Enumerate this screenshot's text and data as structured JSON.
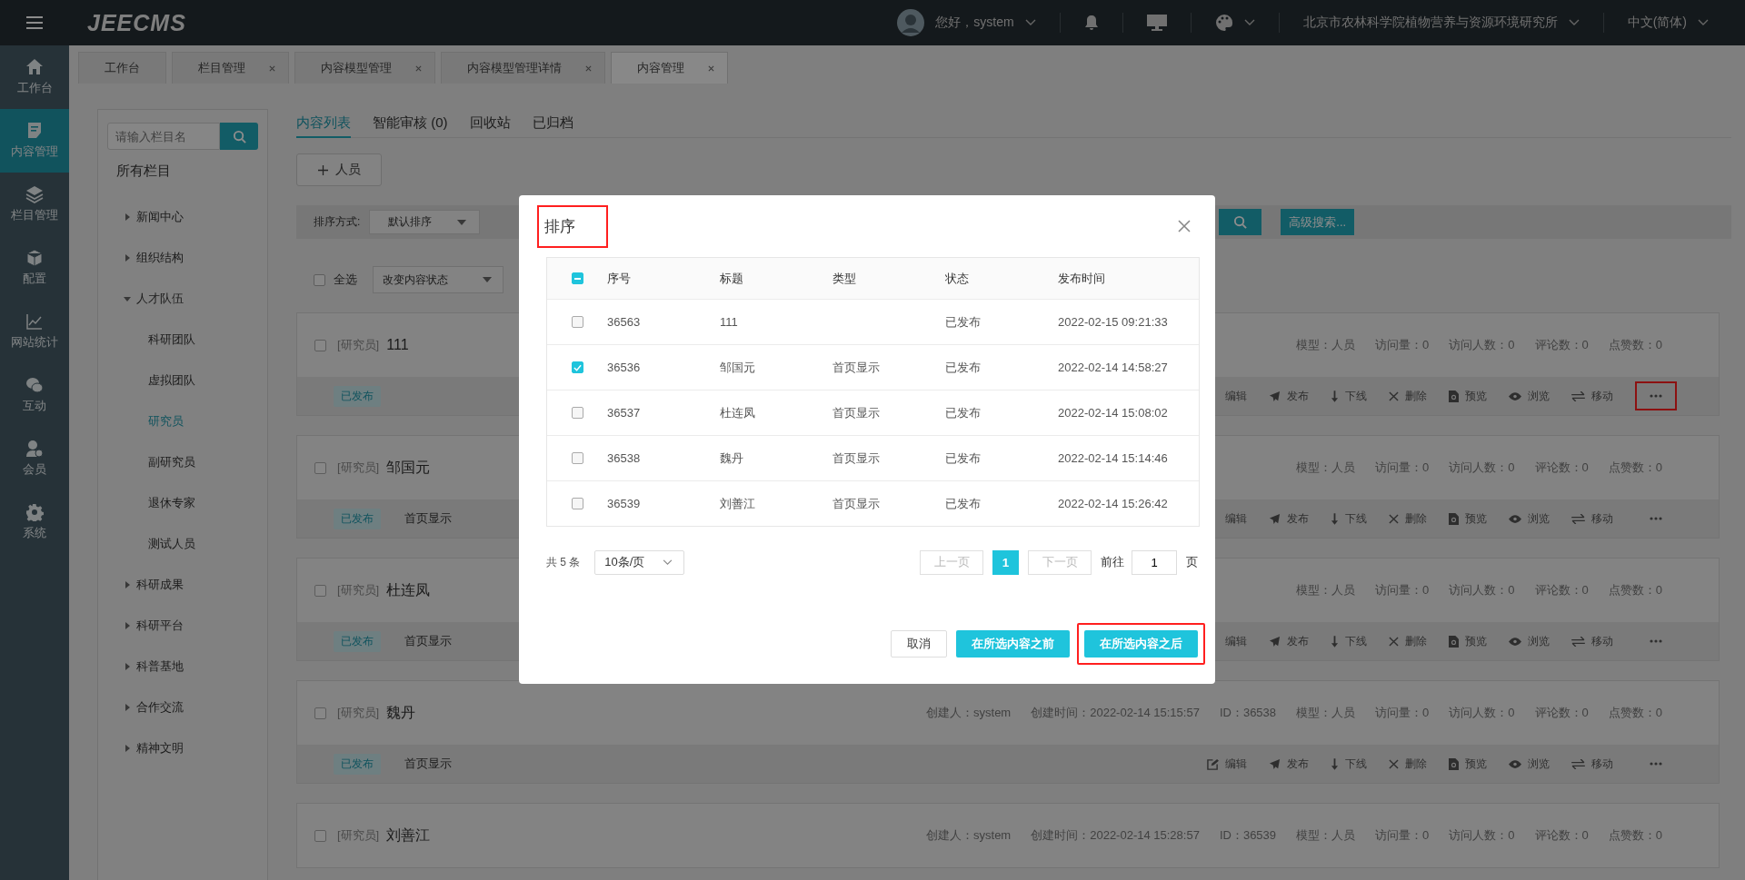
{
  "header": {
    "logo": "JEECMS",
    "greeting": "您好，system",
    "organization": "北京市农林科学院植物营养与资源环境研究所",
    "language": "中文(简体)"
  },
  "nav": [
    {
      "label": "工作台",
      "selected": false
    },
    {
      "label": "内容管理",
      "selected": true
    },
    {
      "label": "栏目管理",
      "selected": false
    },
    {
      "label": "配置",
      "selected": false
    },
    {
      "label": "网站统计",
      "selected": false
    },
    {
      "label": "互动",
      "selected": false
    },
    {
      "label": "会员",
      "selected": false
    },
    {
      "label": "系统",
      "selected": false
    }
  ],
  "tabs": [
    {
      "label": "工作台",
      "selected": false,
      "closable": false
    },
    {
      "label": "栏目管理",
      "selected": false,
      "closable": true
    },
    {
      "label": "内容模型管理",
      "selected": false,
      "closable": true
    },
    {
      "label": "内容模型管理详情",
      "selected": false,
      "closable": true
    },
    {
      "label": "内容管理",
      "selected": true,
      "closable": true
    }
  ],
  "tree": {
    "search_placeholder": "请输入栏目名",
    "root": "所有栏目",
    "items": [
      {
        "label": "新闻中心",
        "expanded": false,
        "selected": false
      },
      {
        "label": "组织结构",
        "expanded": false,
        "selected": false
      },
      {
        "label": "人才队伍",
        "expanded": true,
        "selected": false,
        "children": [
          {
            "label": "科研团队",
            "selected": false
          },
          {
            "label": "虚拟团队",
            "selected": false
          },
          {
            "label": "研究员",
            "selected": true
          },
          {
            "label": "副研究员",
            "selected": false
          },
          {
            "label": "退休专家",
            "selected": false
          },
          {
            "label": "测试人员",
            "selected": false
          }
        ]
      },
      {
        "label": "科研成果",
        "expanded": false,
        "selected": false
      },
      {
        "label": "科研平台",
        "expanded": false,
        "selected": false
      },
      {
        "label": "科普基地",
        "expanded": false,
        "selected": false
      },
      {
        "label": "合作交流",
        "expanded": false,
        "selected": false
      },
      {
        "label": "精神文明",
        "expanded": false,
        "selected": false
      }
    ]
  },
  "subtabs": [
    {
      "label": "内容列表",
      "selected": true
    },
    {
      "label": "智能审核 (0)",
      "selected": false
    },
    {
      "label": "回收站",
      "selected": false
    },
    {
      "label": "已归档",
      "selected": false
    }
  ],
  "add_button": "人员",
  "filter": {
    "sort_label": "排序方式:",
    "sort_value": "默认排序",
    "advanced": "高级搜索..."
  },
  "bulk": {
    "select_all": "全选",
    "checked": false,
    "status_select": "改变内容状态"
  },
  "cards": [
    {
      "checked": false,
      "category": "[研究员]",
      "title": "111",
      "status": "已发布",
      "meta": [
        "模型：人员",
        "访问量：0",
        "访问人数：0",
        "评论数：0",
        "点赞数：0"
      ],
      "actions": [
        {
          "kind": "edit",
          "label": "编辑",
          "icon": false
        },
        {
          "kind": "publish",
          "label": "发布"
        },
        {
          "kind": "offline",
          "label": "下线"
        },
        {
          "kind": "delete",
          "label": "删除"
        },
        {
          "kind": "preview",
          "label": "预览"
        },
        {
          "kind": "view",
          "label": "浏览"
        },
        {
          "kind": "move",
          "label": "移动"
        },
        {
          "kind": "more",
          "highlighted": true
        }
      ]
    },
    {
      "checked": false,
      "category": "[研究员]",
      "title": "邹国元",
      "status": "已发布",
      "type": "首页显示",
      "meta": [
        "模型：人员",
        "访问量：0",
        "访问人数：0",
        "评论数：0",
        "点赞数：0"
      ],
      "actions": [
        {
          "kind": "edit",
          "label": "编辑",
          "icon": false
        },
        {
          "kind": "publish",
          "label": "发布"
        },
        {
          "kind": "offline",
          "label": "下线"
        },
        {
          "kind": "delete",
          "label": "删除"
        },
        {
          "kind": "preview",
          "label": "预览"
        },
        {
          "kind": "view",
          "label": "浏览"
        },
        {
          "kind": "move",
          "label": "移动"
        },
        {
          "kind": "more",
          "highlighted": false
        }
      ]
    },
    {
      "checked": false,
      "category": "[研究员]",
      "title": "杜连凤",
      "status": "已发布",
      "type": "首页显示",
      "meta": [
        "模型：人员",
        "访问量：0",
        "访问人数：0",
        "评论数：0",
        "点赞数：0"
      ],
      "actions": [
        {
          "kind": "edit",
          "label": "编辑",
          "icon": false
        },
        {
          "kind": "publish",
          "label": "发布"
        },
        {
          "kind": "offline",
          "label": "下线"
        },
        {
          "kind": "delete",
          "label": "删除"
        },
        {
          "kind": "preview",
          "label": "预览"
        },
        {
          "kind": "view",
          "label": "浏览"
        },
        {
          "kind": "move",
          "label": "移动"
        },
        {
          "kind": "more",
          "highlighted": false
        }
      ]
    },
    {
      "checked": false,
      "category": "[研究员]",
      "title": "魏丹",
      "status": "已发布",
      "type": "首页显示",
      "meta": [
        "创建人：system",
        "创建时间：2022-02-14 15:15:57",
        "ID：36538",
        "模型：人员",
        "访问量：0",
        "访问人数：0",
        "评论数：0",
        "点赞数：0"
      ],
      "actions": [
        {
          "kind": "edit",
          "label": "编辑",
          "icon": true
        },
        {
          "kind": "publish",
          "label": "发布"
        },
        {
          "kind": "offline",
          "label": "下线"
        },
        {
          "kind": "delete",
          "label": "删除"
        },
        {
          "kind": "preview",
          "label": "预览"
        },
        {
          "kind": "view",
          "label": "浏览"
        },
        {
          "kind": "move",
          "label": "移动"
        },
        {
          "kind": "more",
          "highlighted": false
        }
      ]
    },
    {
      "checked": false,
      "category": "[研究员]",
      "title": "刘善江",
      "meta": [
        "创建人：system",
        "创建时间：2022-02-14 15:28:57",
        "ID：36539",
        "模型：人员",
        "访问量：0",
        "访问人数：0",
        "评论数：0",
        "点赞数：0"
      ]
    }
  ],
  "dialog": {
    "title": "排序",
    "title_highlighted": true,
    "header_indeterminate": true,
    "columns": [
      "序号",
      "标题",
      "类型",
      "状态",
      "发布时间"
    ],
    "rows": [
      {
        "checked": false,
        "cells": [
          "36563",
          "111",
          "",
          "已发布",
          "2022-02-15 09:21:33"
        ]
      },
      {
        "checked": true,
        "cells": [
          "36536",
          "邹国元",
          "首页显示",
          "已发布",
          "2022-02-14 14:58:27"
        ]
      },
      {
        "checked": false,
        "cells": [
          "36537",
          "杜连凤",
          "首页显示",
          "已发布",
          "2022-02-14 15:08:02"
        ]
      },
      {
        "checked": false,
        "cells": [
          "36538",
          "魏丹",
          "首页显示",
          "已发布",
          "2022-02-14 15:14:46"
        ]
      },
      {
        "checked": false,
        "cells": [
          "36539",
          "刘善江",
          "首页显示",
          "已发布",
          "2022-02-14 15:26:42"
        ]
      }
    ],
    "pagination": {
      "total": "共 5 条",
      "page_size": "10条/页",
      "prev": "上一页",
      "prev_disabled": true,
      "pages": [
        {
          "label": "1",
          "selected": true
        }
      ],
      "next": "下一页",
      "next_disabled": true,
      "goto": "前往",
      "goto_value": "1",
      "page_unit": "页"
    },
    "buttons": [
      {
        "kind": "plain",
        "label": "取消",
        "highlighted": false
      },
      {
        "kind": "primary",
        "label": "在所选内容之前",
        "highlighted": false
      },
      {
        "kind": "primary",
        "label": "在所选内容之后",
        "highlighted": true
      }
    ]
  }
}
